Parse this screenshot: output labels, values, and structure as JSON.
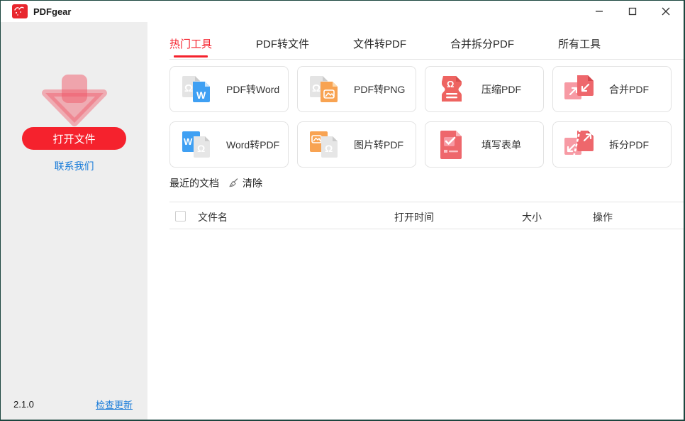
{
  "window": {
    "title": "PDFgear"
  },
  "sidebar": {
    "open_button": "打开文件",
    "contact_link": "联系我们",
    "version": "2.1.0",
    "update_link": "检查更新"
  },
  "tabs": [
    {
      "label": "热门工具",
      "active": true
    },
    {
      "label": "PDF转文件",
      "active": false
    },
    {
      "label": "文件转PDF",
      "active": false
    },
    {
      "label": "合并拆分PDF",
      "active": false
    },
    {
      "label": "所有工具",
      "active": false
    }
  ],
  "tools": [
    {
      "label": "PDF转Word",
      "icon": "pdf-to-word-icon"
    },
    {
      "label": "PDF转PNG",
      "icon": "pdf-to-png-icon"
    },
    {
      "label": "压缩PDF",
      "icon": "compress-pdf-icon"
    },
    {
      "label": "合并PDF",
      "icon": "merge-pdf-icon"
    },
    {
      "label": "Word转PDF",
      "icon": "word-to-pdf-icon"
    },
    {
      "label": "图片转PDF",
      "icon": "image-to-pdf-icon"
    },
    {
      "label": "填写表单",
      "icon": "fill-form-icon"
    },
    {
      "label": "拆分PDF",
      "icon": "split-pdf-icon"
    }
  ],
  "recent": {
    "title": "最近的文档",
    "clear_label": "清除",
    "columns": [
      "文件名",
      "打开时间",
      "大小",
      "操作"
    ],
    "rows": []
  },
  "colors": {
    "accent_red": "#f5222d",
    "link_blue": "#1a7cd9",
    "icon_coral": "#ee676c",
    "icon_pink": "#f79aa4",
    "icon_blue": "#3fa0f3",
    "icon_orange": "#f8a352",
    "sidebar_bg": "#eeeeee",
    "window_border": "#1c463f"
  }
}
